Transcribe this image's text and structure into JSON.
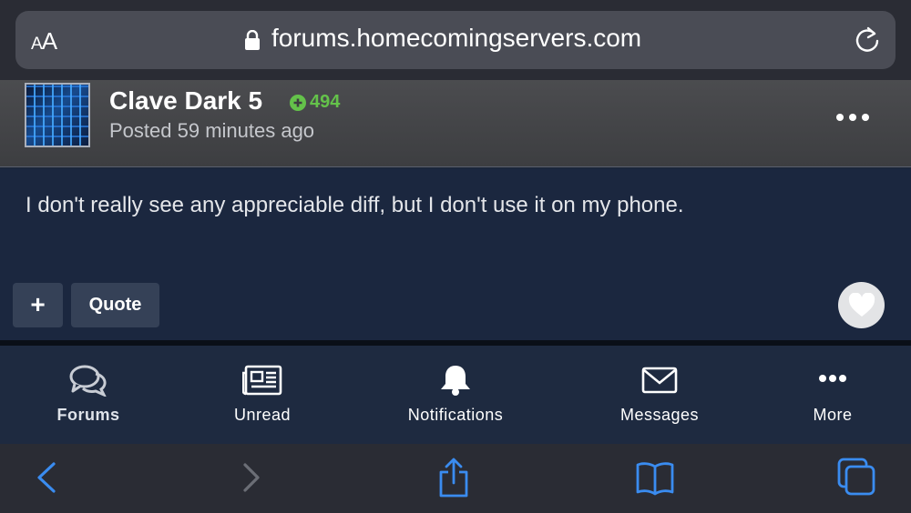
{
  "browser": {
    "text_size_label": "AA",
    "url": "forums.homecomingservers.com",
    "icons": {
      "lock": "lock-icon",
      "reload": "reload-icon"
    }
  },
  "post": {
    "author": "Clave Dark 5",
    "reputation": "494",
    "posted": "Posted 59 minutes ago",
    "body": "I don't really see any appreciable diff, but I don't use it on my phone.",
    "actions": {
      "plus_label": "+",
      "quote_label": "Quote"
    }
  },
  "tabs": [
    {
      "label": "Forums",
      "icon": "chat-bubbles-icon",
      "active": true
    },
    {
      "label": "Unread",
      "icon": "newspaper-icon"
    },
    {
      "label": "Notifications",
      "icon": "bell-icon"
    },
    {
      "label": "Messages",
      "icon": "envelope-icon"
    },
    {
      "label": "More",
      "icon": "ellipsis-icon"
    }
  ],
  "toolbar": {
    "items": [
      "back-icon",
      "forward-icon",
      "share-icon",
      "bookmarks-icon",
      "tabs-icon"
    ]
  },
  "colors": {
    "accent_blue": "#3a8cf0",
    "reputation_green": "#64c24a",
    "post_body_bg": "#1b273f",
    "tabbar_bg": "#1e2a40"
  }
}
